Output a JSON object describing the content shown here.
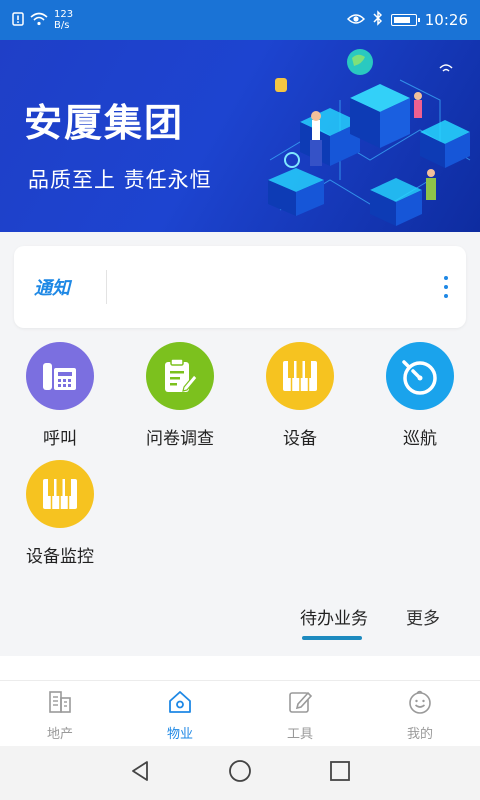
{
  "status_bar": {
    "speed_value": "123",
    "speed_unit": "B/s",
    "time": "10:26",
    "battery_level": 0.85
  },
  "banner": {
    "title": "安厦集团",
    "slogan": "品质至上 责任永恒"
  },
  "notice": {
    "label": "通知",
    "icon": "more-vertical-icon"
  },
  "grid": [
    {
      "label": "呼叫",
      "icon": "phone-icon",
      "color": "#7b6fe0"
    },
    {
      "label": "问卷调查",
      "icon": "clipboard-edit-icon",
      "color": "#7cc11e"
    },
    {
      "label": "设备",
      "icon": "piano-keys-icon",
      "color": "#f6c320"
    },
    {
      "label": "巡航",
      "icon": "stopwatch-icon",
      "color": "#1aa3ec"
    },
    {
      "label": "设备监控",
      "icon": "piano-keys-icon",
      "color": "#f6c320"
    }
  ],
  "tabs": {
    "todo": "待办业务",
    "more": "更多"
  },
  "bottom_nav": [
    {
      "label": "地产",
      "icon": "building-icon",
      "active": false
    },
    {
      "label": "物业",
      "icon": "home-icon",
      "active": true
    },
    {
      "label": "工具",
      "icon": "edit-icon",
      "active": false
    },
    {
      "label": "我的",
      "icon": "smile-icon",
      "active": false
    }
  ],
  "colors": {
    "status_bar": "#1a73d6",
    "accent": "#1e88e5",
    "tab_underline": "#1d8abf"
  }
}
